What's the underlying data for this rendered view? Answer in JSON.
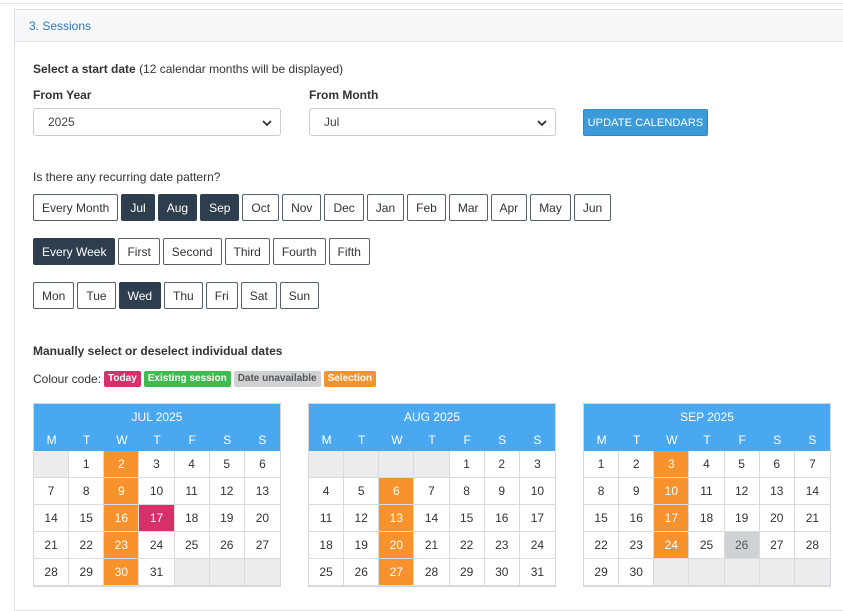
{
  "section": {
    "title": "3. Sessions"
  },
  "start": {
    "heading": "Select a start date",
    "note": "(12 calendar months will be displayed)"
  },
  "from_year": {
    "label": "From Year",
    "value": "2025"
  },
  "from_month": {
    "label": "From Month",
    "value": "Jul"
  },
  "update_label": "UPDATE CALENDARS",
  "recurring_question": "Is there any recurring date pattern?",
  "months_row": [
    {
      "label": "Every Month",
      "on": false
    },
    {
      "label": "Jul",
      "on": true
    },
    {
      "label": "Aug",
      "on": true
    },
    {
      "label": "Sep",
      "on": true
    },
    {
      "label": "Oct",
      "on": false
    },
    {
      "label": "Nov",
      "on": false
    },
    {
      "label": "Dec",
      "on": false
    },
    {
      "label": "Jan",
      "on": false
    },
    {
      "label": "Feb",
      "on": false
    },
    {
      "label": "Mar",
      "on": false
    },
    {
      "label": "Apr",
      "on": false
    },
    {
      "label": "May",
      "on": false
    },
    {
      "label": "Jun",
      "on": false
    }
  ],
  "weeks_row": [
    {
      "label": "Every Week",
      "on": true
    },
    {
      "label": "First",
      "on": false
    },
    {
      "label": "Second",
      "on": false
    },
    {
      "label": "Third",
      "on": false
    },
    {
      "label": "Fourth",
      "on": false
    },
    {
      "label": "Fifth",
      "on": false
    }
  ],
  "days_row": [
    {
      "label": "Mon",
      "on": false
    },
    {
      "label": "Tue",
      "on": false
    },
    {
      "label": "Wed",
      "on": true
    },
    {
      "label": "Thu",
      "on": false
    },
    {
      "label": "Fri",
      "on": false
    },
    {
      "label": "Sat",
      "on": false
    },
    {
      "label": "Sun",
      "on": false
    }
  ],
  "manual_heading": "Manually select or deselect individual dates",
  "colour_code": {
    "label": "Colour code:",
    "items": [
      {
        "text": "Today",
        "color": "#d72f6a",
        "text_color": "#ffffff"
      },
      {
        "text": "Existing session",
        "color": "#3dbb4f",
        "text_color": "#ffffff"
      },
      {
        "text": "Date unavailable",
        "color": "#cfd2d5",
        "text_color": "#555555"
      },
      {
        "text": "Selection",
        "color": "#f7922d",
        "text_color": "#ffffff"
      }
    ]
  },
  "dow": [
    "M",
    "T",
    "W",
    "T",
    "F",
    "S",
    "S"
  ],
  "calendars": [
    {
      "title": "JUL 2025",
      "lead": 1,
      "days": 31,
      "selected": [
        2,
        9,
        16,
        23,
        30
      ],
      "today": [
        17
      ],
      "unavailable": []
    },
    {
      "title": "AUG 2025",
      "lead": 4,
      "days": 31,
      "selected": [
        6,
        13,
        20,
        27
      ],
      "today": [],
      "unavailable": []
    },
    {
      "title": "SEP 2025",
      "lead": 0,
      "days": 30,
      "selected": [
        3,
        10,
        17,
        24
      ],
      "today": [],
      "unavailable": [
        26
      ]
    }
  ]
}
